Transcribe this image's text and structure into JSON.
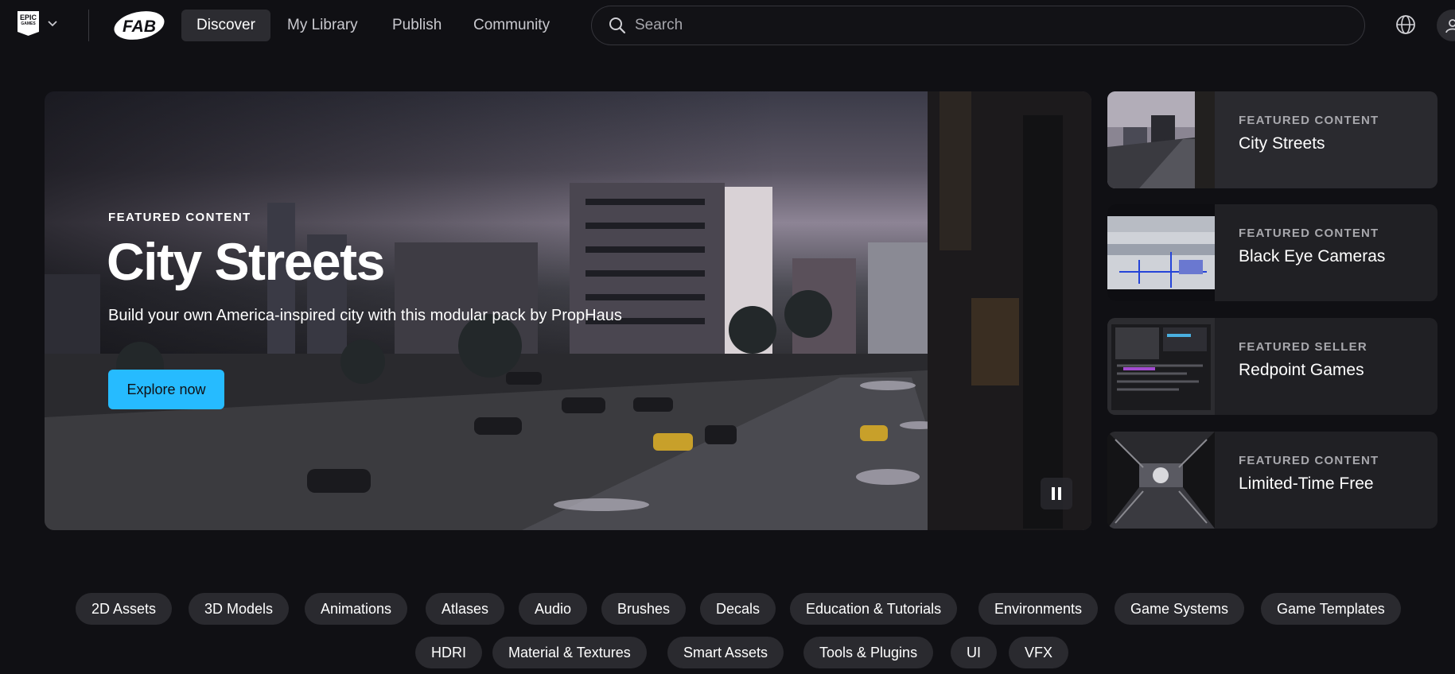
{
  "nav": {
    "epic_logo_text": "EPIC",
    "epic_logo_sub": "GAMES",
    "fab_logo_text": "FAB",
    "tabs": [
      {
        "label": "Discover",
        "active": true
      },
      {
        "label": "My Library",
        "active": false
      },
      {
        "label": "Publish",
        "active": false
      },
      {
        "label": "Community",
        "active": false
      }
    ],
    "search_placeholder": "Search"
  },
  "hero": {
    "eyebrow": "FEATURED CONTENT",
    "title": "City Streets",
    "subtitle": "Build your own America-inspired city with this modular pack by PropHaus",
    "cta": "Explore now"
  },
  "side_cards": [
    {
      "eyebrow": "FEATURED CONTENT",
      "title": "City Streets",
      "selected": true
    },
    {
      "eyebrow": "FEATURED CONTENT",
      "title": "Black Eye Cameras",
      "selected": false
    },
    {
      "eyebrow": "FEATURED SELLER",
      "title": "Redpoint Games",
      "selected": false
    },
    {
      "eyebrow": "FEATURED CONTENT",
      "title": "Limited-Time Free",
      "selected": false
    }
  ],
  "categories": [
    "2D Assets",
    "3D Models",
    "Animations",
    "Atlases",
    "Audio",
    "Brushes",
    "Decals",
    "Education & Tutorials",
    "Environments",
    "Game Systems",
    "Game Templates",
    "HDRI",
    "Material & Textures",
    "Smart Assets",
    "Tools & Plugins",
    "UI",
    "VFX"
  ],
  "colors": {
    "background": "#101014",
    "accent": "#26bbff",
    "chip": "#2a2a2f",
    "card": "#202024"
  },
  "icons": [
    "epic-games-logo",
    "chevron-down-icon",
    "fab-logo",
    "search-icon",
    "globe-icon",
    "user-icon",
    "pause-icon"
  ]
}
